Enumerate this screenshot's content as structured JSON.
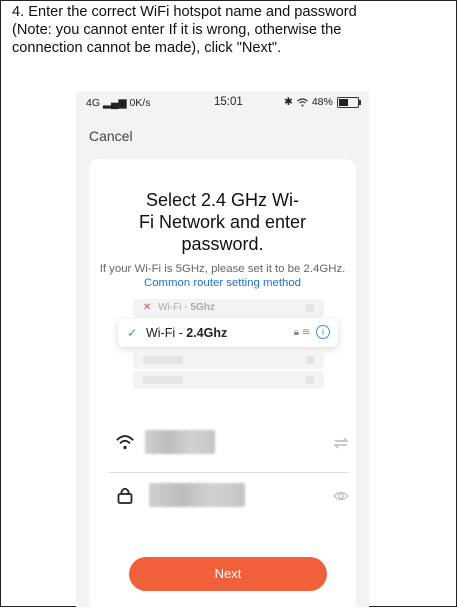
{
  "instruction": {
    "lines": [
      "4. Enter the correct WiFi hotspot name and password",
      "(Note: you cannot enter If it is wrong, otherwise the",
      "connection cannot be made), click \"Next\"."
    ]
  },
  "status_bar": {
    "network": "4G",
    "speed": "0K/s",
    "time": "15:01",
    "battery": "48%"
  },
  "header": {
    "cancel_label": "Cancel"
  },
  "card": {
    "title_lines": [
      "Select 2.4 GHz Wi-",
      "Fi Network and enter",
      "password."
    ],
    "subtitle_prefix": "If your Wi-Fi is 5GHz, please set it to be 2.4GHz.",
    "subtitle_link": "Common router setting method"
  },
  "illustration": {
    "wifi_5g_prefix": "Wi-Fi -",
    "wifi_5g_band": "5Ghz",
    "wifi_24_prefix": "Wi-Fi -",
    "wifi_24_band": "2.4Ghz"
  },
  "actions": {
    "next_label": "Next"
  },
  "colors": {
    "accent": "#f0613b",
    "link": "#1f6fd0",
    "check": "#2fb36b",
    "error": "#e34a3a"
  }
}
